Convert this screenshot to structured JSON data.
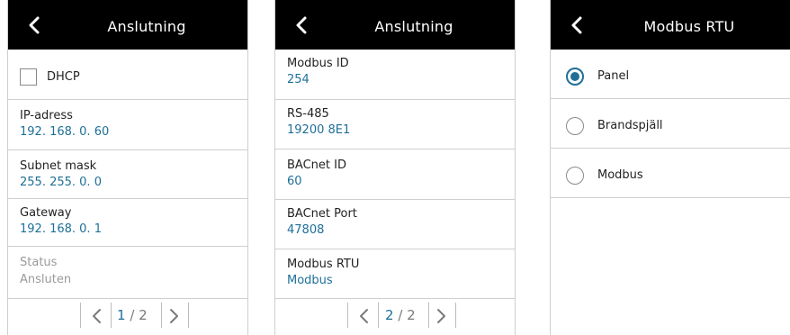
{
  "panel1": {
    "title": "Anslutning",
    "dhcp_label": "DHCP",
    "dhcp_checked": false,
    "rows": [
      {
        "label": "IP-adress",
        "value": "192. 168. 0. 60"
      },
      {
        "label": "Subnet mask",
        "value": "255. 255. 0. 0"
      },
      {
        "label": "Gateway",
        "value": "192. 168. 0. 1"
      },
      {
        "label": "Status",
        "value": "Ansluten",
        "disabled": true
      }
    ],
    "pager": {
      "current": "1",
      "sep": "/",
      "total": "2"
    }
  },
  "panel2": {
    "title": "Anslutning",
    "rows": [
      {
        "label": "Modbus ID",
        "value": "254"
      },
      {
        "label": "RS-485",
        "value": "19200 8E1"
      },
      {
        "label": "BACnet ID",
        "value": "60"
      },
      {
        "label": "BACnet Port",
        "value": "47808"
      },
      {
        "label": "Modbus RTU",
        "value": "Modbus"
      }
    ],
    "pager": {
      "current": "2",
      "sep": "/",
      "total": "2"
    }
  },
  "panel3": {
    "title": "Modbus RTU",
    "options": [
      {
        "label": "Panel",
        "selected": true
      },
      {
        "label": "Brandspjäll",
        "selected": false
      },
      {
        "label": "Modbus",
        "selected": false
      }
    ]
  },
  "colors": {
    "header_bg": "#000000",
    "value_text": "#1e6f98",
    "disabled_text": "#9a9a9a",
    "divider": "#cfcfcf"
  },
  "icons": {
    "back": "chevron-left-icon",
    "prev": "chevron-left-icon",
    "next": "chevron-right-icon"
  }
}
